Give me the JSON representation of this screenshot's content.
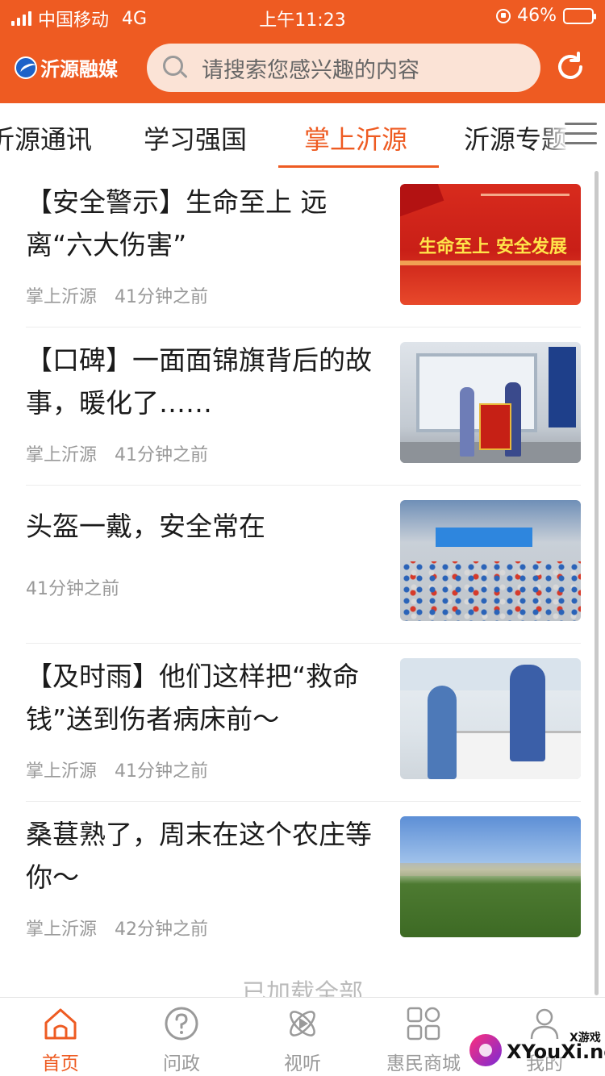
{
  "status_bar": {
    "carrier": "中国移动",
    "network": "4G",
    "time": "上午11:23",
    "battery_pct": "46%",
    "battery_level": 0.46
  },
  "app_bar": {
    "logo_text": "沂源融媒",
    "search_placeholder": "请搜索您感兴趣的内容",
    "refresh_icon": "refresh-icon"
  },
  "tabs": [
    {
      "label": "沂源通讯",
      "active": false
    },
    {
      "label": "学习强国",
      "active": false
    },
    {
      "label": "掌上沂源",
      "active": true
    },
    {
      "label": "沂源专题",
      "active": false
    }
  ],
  "feed": [
    {
      "title": "【安全警示】生命至上 远离“六大伤害”",
      "source": "掌上沂源",
      "time": "41分钟之前",
      "thumb_text": "生命至上 安全发展"
    },
    {
      "title": "【口碑】一面面锦旗背后的故事，暖化了……",
      "source": "掌上沂源",
      "time": "41分钟之前"
    },
    {
      "title": "头盔一戴，安全常在",
      "source": "",
      "time": "41分钟之前"
    },
    {
      "title": "【及时雨】他们这样把“救命钱”送到伤者病床前～",
      "source": "掌上沂源",
      "time": "41分钟之前"
    },
    {
      "title": "桑葚熟了，周末在这个农庄等你～",
      "source": "掌上沂源",
      "time": "42分钟之前"
    }
  ],
  "feed_end_text": "已加载全部",
  "bottom_nav": [
    {
      "label": "首页",
      "icon": "home-icon",
      "active": true
    },
    {
      "label": "问政",
      "icon": "question-icon",
      "active": false
    },
    {
      "label": "视听",
      "icon": "media-play-icon",
      "active": false
    },
    {
      "label": "惠民商城",
      "icon": "grid-icon",
      "active": false
    },
    {
      "label": "我的",
      "icon": "user-icon",
      "active": false
    }
  ],
  "watermark": {
    "small": "X游戏",
    "text": "XYouXi.net"
  },
  "colors": {
    "brand": "#ee5b22",
    "text": "#1b1b1b",
    "muted": "#999999"
  }
}
